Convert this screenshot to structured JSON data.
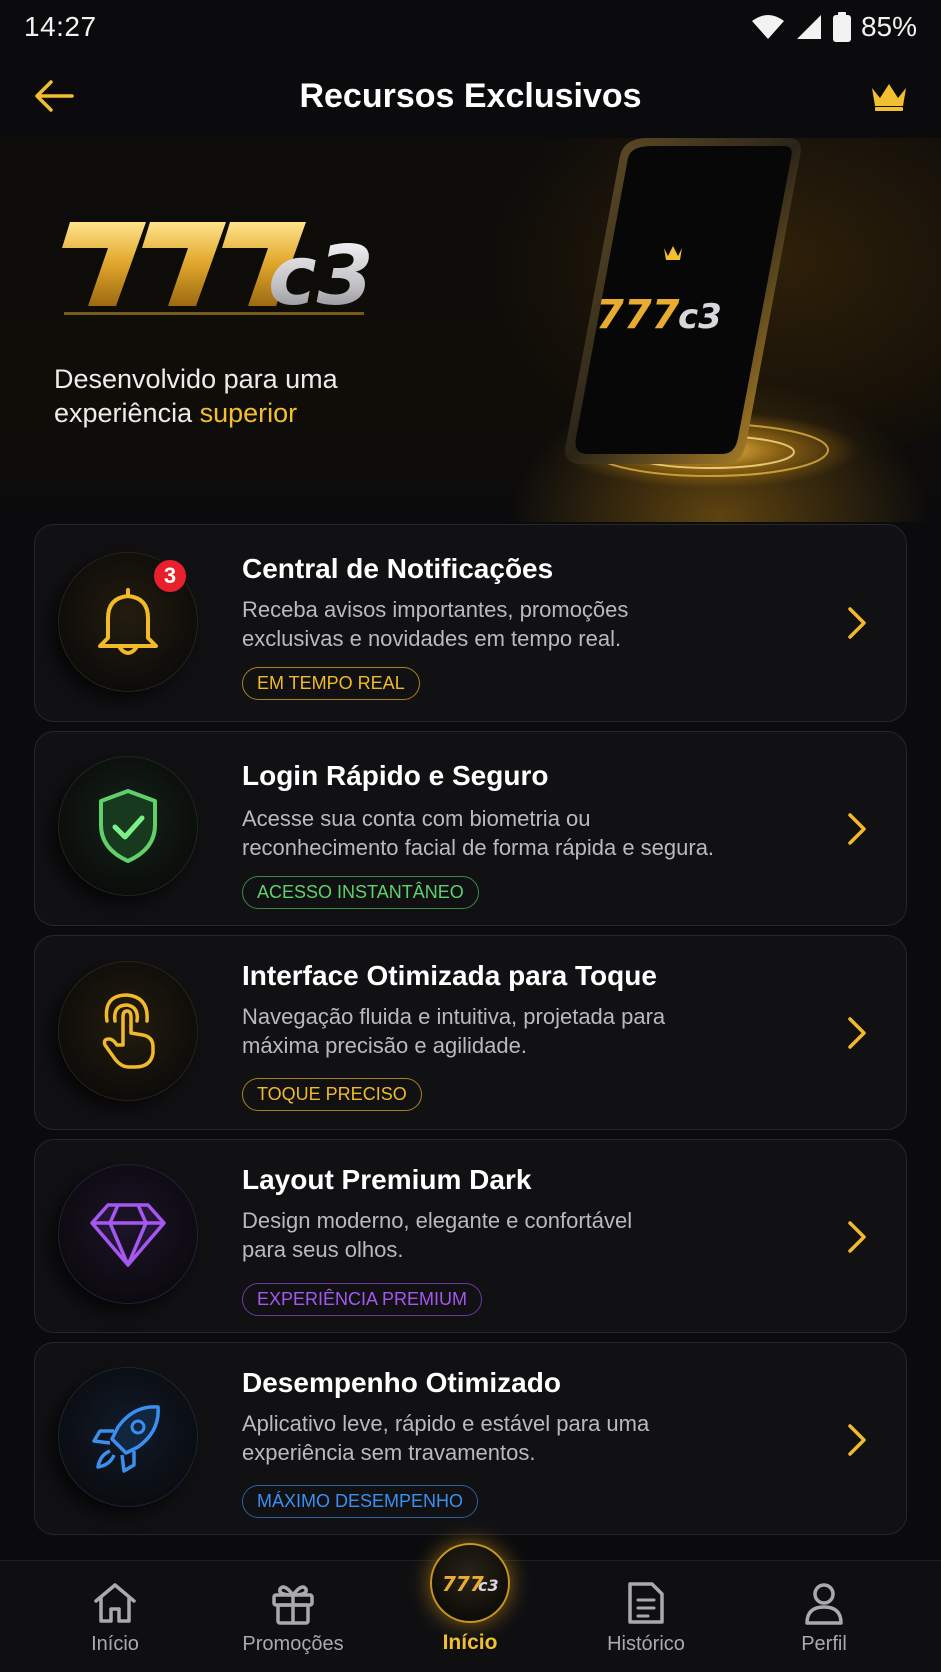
{
  "status_bar": {
    "time": "14:27",
    "battery": "85%"
  },
  "header": {
    "title": "Recursos Exclusivos"
  },
  "hero": {
    "logo_text": "777c3",
    "subtitle_line1": "Desenvolvido para uma",
    "subtitle_line2_prefix": "experiência ",
    "subtitle_line2_accent": "superior"
  },
  "features": [
    {
      "title": "Central de Notificações",
      "desc_line1": "Receba avisos importantes, promoções",
      "desc_line2": "exclusivas e novidades em tempo real.",
      "tag": "EM TEMPO REAL",
      "badge": "3",
      "icon": "bell-icon",
      "color": "#f2b92b"
    },
    {
      "title": "Login Rápido e Seguro",
      "desc_line1": "Acesse sua conta com biometria ou",
      "desc_line2": "reconhecimento facial de forma rápida e segura.",
      "tag": "ACESSO INSTANTÂNEO",
      "icon": "shield-check-icon",
      "color": "#5fd16a"
    },
    {
      "title": "Interface Otimizada para Toque",
      "desc_line1": "Navegação fluida e intuitiva, projetada para",
      "desc_line2": "máxima precisão e agilidade.",
      "tag": "TOQUE PRECISO",
      "icon": "touch-icon",
      "color": "#f2b92b"
    },
    {
      "title": "Layout Premium Dark",
      "desc_line1": "Design moderno, elegante e confortável",
      "desc_line2": "para seus olhos.",
      "tag": "EXPERIÊNCIA PREMIUM",
      "icon": "diamond-icon",
      "color": "#a657f0"
    },
    {
      "title": "Desempenho Otimizado",
      "desc_line1": "Aplicativo leve, rápido e estável para uma",
      "desc_line2": "experiência sem travamentos.",
      "tag": "MÁXIMO DESEMPENHO",
      "icon": "rocket-icon",
      "color": "#3a8ff0"
    }
  ],
  "bottom_nav": {
    "items": [
      {
        "label": "Início",
        "icon": "home-icon"
      },
      {
        "label": "Promoções",
        "icon": "gift-icon"
      },
      {
        "label": "Início",
        "icon": "777c3-logo-icon",
        "active": true
      },
      {
        "label": "Histórico",
        "icon": "document-icon"
      },
      {
        "label": "Perfil",
        "icon": "user-icon"
      }
    ]
  }
}
